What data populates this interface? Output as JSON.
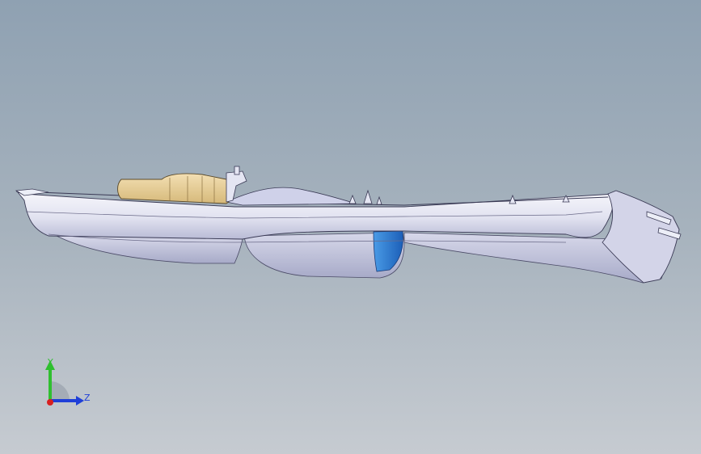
{
  "scene": {
    "background_top": "#8fa1b2",
    "background_bottom": "#c6cbd1",
    "part_body_color": "#e6e7f3",
    "part_shade_color": "#b7b9d4",
    "accent_tan_color": "#e8d09a",
    "accent_blue_color": "#2f7fd0"
  },
  "triad": {
    "y_label": "Y",
    "z_label": "Z",
    "y_color": "#2fbf2f",
    "z_color": "#1f3fd8",
    "x_color": "#d82020"
  }
}
